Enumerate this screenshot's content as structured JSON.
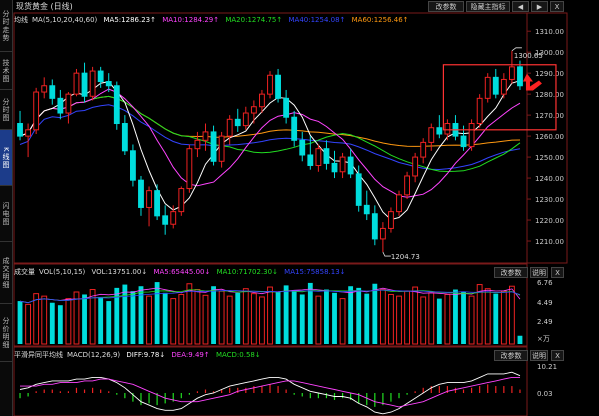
{
  "window": {
    "title": "现货黄金 (日线)",
    "buttons": {
      "params": "改参数",
      "sub_indicator": "隐藏主指标",
      "prev": "◀",
      "next": "▶",
      "close": "X"
    }
  },
  "left_tabs": [
    "分时走势",
    "技术图",
    "分时图",
    "K线图",
    "闪电图",
    "成交明细",
    "分价明细"
  ],
  "left_tabs_active": 3,
  "main_legend": {
    "name": "均线",
    "params": "MA(5,10,20,40,60)",
    "ma5": "MA5:1286.23↑",
    "ma10": "MA10:1284.29↑",
    "ma20": "MA20:1274.75↑",
    "ma40": "MA40:1254.08↑",
    "ma60": "MA60:1256.46↑",
    "colors": {
      "ma5": "#ffffff",
      "ma10": "#ff44ff",
      "ma20": "#22dd22",
      "ma40": "#3344ff",
      "ma60": "#ff9911"
    }
  },
  "price_axis": [
    "1310.00",
    "1300.00",
    "1290.00",
    "1280.00",
    "1270.00",
    "1260.00",
    "1250.00",
    "1240.00",
    "1230.00",
    "1220.00",
    "1210.00"
  ],
  "annotations": {
    "high": "1300.65",
    "low": "1204.73"
  },
  "volume_panel": {
    "title": "成交量",
    "params": "VOL(5,10,15)",
    "vol": "VOL:13751.00↓",
    "ma5": "MA5:65445.00↓",
    "ma10": "MA10:71702.30↓",
    "ma15": "MA15:75858.13↓",
    "buttons": {
      "params": "改参数",
      "help": "说明",
      "close": "X"
    },
    "axis": [
      "6.76",
      "4.49",
      "2.49",
      "×万"
    ]
  },
  "macd_panel": {
    "title": "平滑异同平均线",
    "params": "MACD(12,26,9)",
    "diff": "DIFF:9.78↓",
    "dea": "DEA:9.49↑",
    "macd": "MACD:0.58↓",
    "buttons": {
      "params": "改参数",
      "help": "说明",
      "close": "X"
    },
    "axis": [
      "10.21",
      "0.03"
    ]
  },
  "colors": {
    "up": "#ee2222",
    "down": "#00dddd",
    "highlight_box": "#ff3333",
    "arrow": "#ff2222"
  },
  "chart_data": {
    "type": "candlestick",
    "ylim": [
      1200,
      1312
    ],
    "candles": [
      [
        1266,
        1272,
        1258,
        1260
      ],
      [
        1260,
        1266,
        1250,
        1263
      ],
      [
        1263,
        1283,
        1261,
        1281
      ],
      [
        1281,
        1288,
        1278,
        1284
      ],
      [
        1284,
        1287,
        1275,
        1278
      ],
      [
        1278,
        1282,
        1268,
        1271
      ],
      [
        1271,
        1281,
        1266,
        1280
      ],
      [
        1280,
        1292,
        1279,
        1290
      ],
      [
        1290,
        1295,
        1276,
        1279
      ],
      [
        1279,
        1293,
        1277,
        1291
      ],
      [
        1291,
        1293,
        1283,
        1286
      ],
      [
        1286,
        1290,
        1281,
        1284
      ],
      [
        1284,
        1286,
        1263,
        1266
      ],
      [
        1266,
        1270,
        1251,
        1253
      ],
      [
        1253,
        1256,
        1236,
        1239
      ],
      [
        1239,
        1241,
        1222,
        1226
      ],
      [
        1226,
        1236,
        1217,
        1234
      ],
      [
        1234,
        1237,
        1220,
        1222
      ],
      [
        1222,
        1227,
        1213,
        1218
      ],
      [
        1218,
        1227,
        1216,
        1224
      ],
      [
        1224,
        1236,
        1222,
        1235
      ],
      [
        1235,
        1256,
        1233,
        1254
      ],
      [
        1254,
        1262,
        1250,
        1258
      ],
      [
        1258,
        1266,
        1253,
        1262
      ],
      [
        1262,
        1265,
        1246,
        1248
      ],
      [
        1248,
        1262,
        1245,
        1260
      ],
      [
        1260,
        1270,
        1256,
        1268
      ],
      [
        1268,
        1273,
        1262,
        1265
      ],
      [
        1265,
        1274,
        1263,
        1271
      ],
      [
        1271,
        1277,
        1266,
        1274
      ],
      [
        1274,
        1282,
        1271,
        1280
      ],
      [
        1280,
        1291,
        1278,
        1289
      ],
      [
        1289,
        1292,
        1276,
        1278
      ],
      [
        1278,
        1282,
        1266,
        1269
      ],
      [
        1269,
        1272,
        1255,
        1258
      ],
      [
        1258,
        1262,
        1248,
        1251
      ],
      [
        1251,
        1260,
        1244,
        1246
      ],
      [
        1246,
        1256,
        1243,
        1254
      ],
      [
        1254,
        1258,
        1244,
        1247
      ],
      [
        1247,
        1253,
        1240,
        1243
      ],
      [
        1243,
        1252,
        1240,
        1250
      ],
      [
        1250,
        1254,
        1240,
        1242
      ],
      [
        1242,
        1246,
        1224,
        1227
      ],
      [
        1227,
        1234,
        1220,
        1223
      ],
      [
        1223,
        1227,
        1208,
        1211
      ],
      [
        1211,
        1219,
        1204.73,
        1216
      ],
      [
        1216,
        1226,
        1214,
        1224
      ],
      [
        1224,
        1234,
        1222,
        1232
      ],
      [
        1232,
        1243,
        1230,
        1241
      ],
      [
        1241,
        1252,
        1238,
        1250
      ],
      [
        1250,
        1259,
        1247,
        1257
      ],
      [
        1257,
        1266,
        1253,
        1264
      ],
      [
        1264,
        1270,
        1259,
        1261
      ],
      [
        1261,
        1268,
        1258,
        1266
      ],
      [
        1266,
        1270,
        1258,
        1260
      ],
      [
        1260,
        1265,
        1253,
        1255
      ],
      [
        1255,
        1268,
        1253,
        1266
      ],
      [
        1266,
        1280,
        1264,
        1278
      ],
      [
        1278,
        1290,
        1276,
        1288
      ],
      [
        1288,
        1292,
        1278,
        1280
      ],
      [
        1280,
        1290,
        1278,
        1287
      ],
      [
        1287,
        1300.65,
        1285,
        1293
      ],
      [
        1293,
        1296,
        1282,
        1284
      ]
    ],
    "volume": [
      52,
      48,
      61,
      58,
      50,
      47,
      55,
      63,
      60,
      66,
      57,
      52,
      68,
      72,
      64,
      70,
      58,
      75,
      62,
      55,
      60,
      73,
      66,
      59,
      70,
      64,
      58,
      62,
      67,
      61,
      57,
      69,
      63,
      71,
      65,
      60,
      74,
      58,
      66,
      62,
      55,
      70,
      68,
      61,
      73,
      66,
      60,
      58,
      64,
      69,
      57,
      62,
      55,
      60,
      66,
      63,
      58,
      72,
      67,
      61,
      64,
      70,
      10
    ],
    "macd_hist": [
      -3,
      -2,
      1,
      2,
      2,
      1,
      1,
      3,
      2,
      3,
      2,
      1,
      -1,
      -3,
      -5,
      -7,
      -6,
      -7,
      -6,
      -5,
      -3,
      -1,
      1,
      2,
      1,
      2,
      3,
      3,
      3,
      4,
      4,
      5,
      4,
      2,
      -1,
      -2,
      -3,
      -3,
      -3,
      -4,
      -3,
      -4,
      -6,
      -7,
      -8,
      -7,
      -5,
      -3,
      -1,
      1,
      3,
      4,
      4,
      4,
      3,
      2,
      3,
      4,
      5,
      4,
      4,
      4,
      2
    ],
    "macd_dif": [
      2,
      3,
      5,
      6,
      7,
      7,
      7,
      8,
      8,
      9,
      9,
      8,
      6,
      3,
      -1,
      -5,
      -7,
      -9,
      -10,
      -10,
      -9,
      -6,
      -3,
      -1,
      0,
      2,
      4,
      5,
      6,
      7,
      8,
      9,
      9,
      8,
      5,
      3,
      1,
      0,
      -1,
      -2,
      -2,
      -3,
      -6,
      -8,
      -11,
      -12,
      -11,
      -9,
      -6,
      -3,
      0,
      3,
      5,
      6,
      6,
      6,
      7,
      9,
      11,
      11,
      11,
      12,
      10
    ],
    "macd_dea": [
      4,
      4,
      4,
      5,
      5,
      6,
      6,
      6,
      7,
      7,
      8,
      8,
      7,
      6,
      5,
      3,
      1,
      -1,
      -3,
      -4,
      -5,
      -5,
      -5,
      -4,
      -3,
      -2,
      -1,
      1,
      2,
      3,
      4,
      5,
      6,
      7,
      7,
      6,
      5,
      4,
      3,
      2,
      1,
      0,
      -1,
      -3,
      -5,
      -6,
      -7,
      -8,
      -7,
      -6,
      -5,
      -3,
      -1,
      1,
      2,
      3,
      4,
      5,
      6,
      7,
      8,
      9,
      9
    ]
  }
}
